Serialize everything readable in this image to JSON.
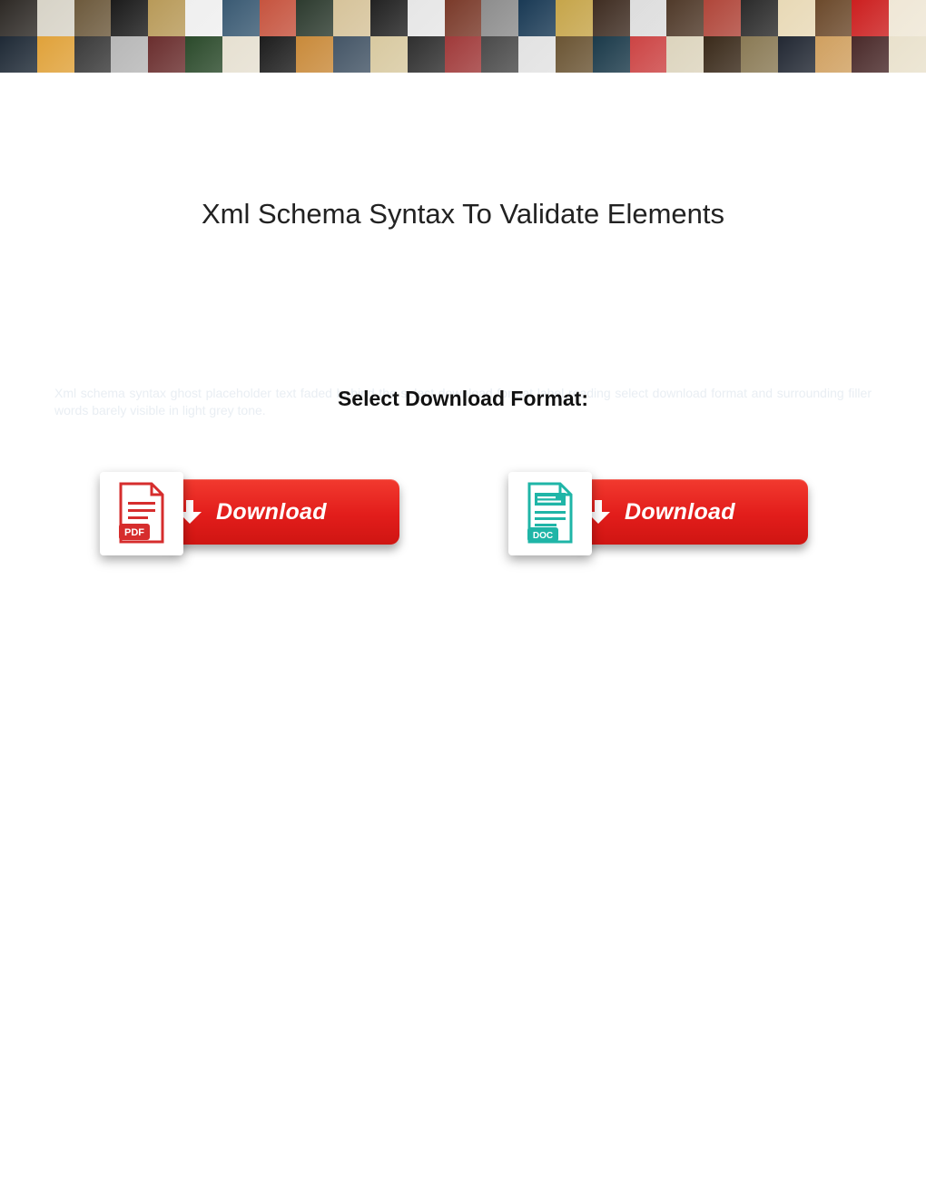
{
  "page_title": "Xml Schema Syntax To Validate Elements",
  "select_label": "Select Download Format:",
  "ghost_blurb": "Xml schema syntax ghost placeholder text faded behind the select download format label reading select download format and surrounding filler words barely visible in light grey tone.",
  "downloads": {
    "pdf": {
      "button_label": "Download",
      "badge_text": "PDF"
    },
    "doc": {
      "button_label": "Download",
      "badge_text": "DOC"
    }
  },
  "banner_colors": [
    "#2e2a26",
    "#d7d3c7",
    "#6d5a3d",
    "#1b1b1b",
    "#b89a59",
    "#efefef",
    "#3a5a73",
    "#c6543f",
    "#2d3b2f",
    "#d6c39a",
    "#222",
    "#e6e6e6",
    "#7a3a2a",
    "#8d8d8d",
    "#1a3a55",
    "#c6a54a",
    "#3f2d22",
    "#dddddd",
    "#503a2a",
    "#b0463a",
    "#2b2b2b",
    "#e8d9b6",
    "#6c4a2c",
    "#cc1f1f",
    "#efe7d6",
    "#1f2a36",
    "#e0a23a",
    "#3a3a3a",
    "#b7b7b7",
    "#6a2e2e",
    "#2b4a2b",
    "#e6e0d1",
    "#1d1d1d",
    "#c98a3a",
    "#445566",
    "#d8c9a0",
    "#2f2f2f",
    "#a03a3a",
    "#4a4a4a",
    "#e2e2e2",
    "#6b5534",
    "#1b3a4a",
    "#c44",
    "#dcd4bd",
    "#3a2a1a",
    "#8a7a55",
    "#222833",
    "#d0a060",
    "#4a2a2a",
    "#e9e1cc"
  ]
}
